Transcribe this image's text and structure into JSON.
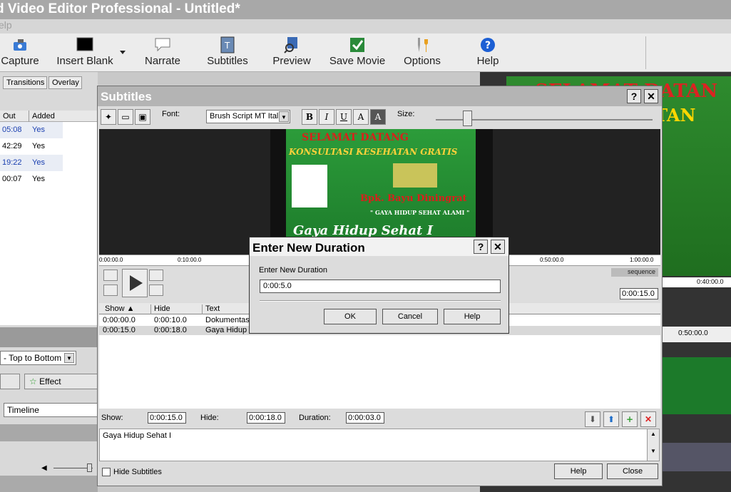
{
  "app": {
    "title": "d Video Editor Professional - Untitled*",
    "menu": "elp"
  },
  "toolbar": {
    "items": [
      {
        "label": "Capture",
        "icon": "capture-icon"
      },
      {
        "label": "Insert Blank",
        "icon": "insert-blank-icon"
      },
      {
        "label": "Narrate",
        "icon": "narrate-icon"
      },
      {
        "label": "Subtitles",
        "icon": "subtitles-icon"
      },
      {
        "label": "Preview",
        "icon": "preview-icon"
      },
      {
        "label": "Save Movie",
        "icon": "save-movie-icon"
      },
      {
        "label": "Options",
        "icon": "options-icon"
      },
      {
        "label": "Help",
        "icon": "help-icon"
      }
    ]
  },
  "left_panel": {
    "tabs": [
      "Transitions",
      "Overlay"
    ],
    "columns": [
      "Out",
      "Added"
    ],
    "rows": [
      {
        "out": "05:08",
        "added": "Yes"
      },
      {
        "out": "42:29",
        "added": "Yes"
      },
      {
        "out": "19:22",
        "added": "Yes"
      },
      {
        "out": "00:07",
        "added": "Yes"
      }
    ],
    "direction_select": "- Top to Bottom",
    "effect_button": "Effect",
    "timeline_field": "Timeline"
  },
  "right_panel": {
    "banner_line1": "SELAMAT DATAN",
    "banner_line2": "EHATAN",
    "ruler_labels": [
      "0:40:00.0",
      "0:50:00.0"
    ]
  },
  "subtitles_dialog": {
    "title": "Subtitles",
    "font_label": "Font:",
    "font_value": "Brush Script MT Ital",
    "size_label": "Size:",
    "format_buttons": [
      "B",
      "I",
      "U",
      "A",
      "A"
    ],
    "poster": {
      "line1": "SELAMAT DATANG",
      "line2": "KONSULTASI KESEHATAN GRATIS",
      "line3": "Bpk. Bayu Diningrat",
      "line4": "\" GAYA HIDUP SEHAT ALAMI \"",
      "line5": "Gaya Hidup Sehat I"
    },
    "ruler": [
      "0:00:00.0",
      "0:10:00.0",
      "0:50:00.0",
      "1:00:00.0"
    ],
    "sequence_label": "sequence",
    "current_time": "0:00:15.0",
    "grid_columns": [
      "Show",
      "Hide",
      "Text"
    ],
    "grid_rows": [
      {
        "show": "0:00:00.0",
        "hide": "0:00:10.0",
        "text": "Dokumentasi"
      },
      {
        "show": "0:00:15.0",
        "hide": "0:00:18.0",
        "text": "Gaya Hidup S"
      }
    ],
    "show_label": "Show:",
    "show_value": "0:00:15.0",
    "hide_label": "Hide:",
    "hide_value": "0:00:18.0",
    "duration_label": "Duration:",
    "duration_value": "0:00:03.0",
    "text_content": "Gaya Hidup Sehat I",
    "hide_subtitles_label": "Hide Subtitles",
    "help_button": "Help",
    "close_button": "Close"
  },
  "duration_dialog": {
    "title": "Enter New Duration",
    "prompt": "Enter New Duration",
    "value": "0:00:5.0",
    "ok_button": "OK",
    "cancel_button": "Cancel",
    "help_button": "Help"
  }
}
